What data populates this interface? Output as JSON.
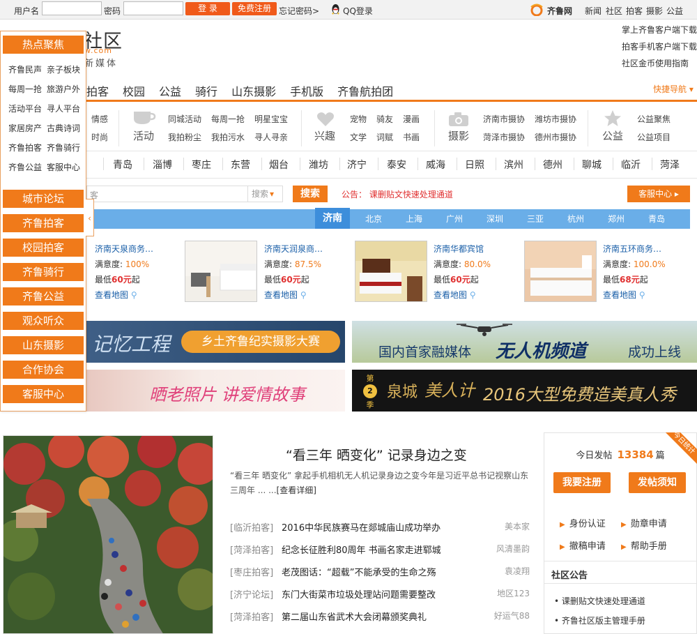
{
  "topbar": {
    "username_label": "用户名",
    "password_label": "密码",
    "login_label": "登  录",
    "register_label": "免费注册",
    "forgot_label": "忘记密码>",
    "qq_label": "QQ登录",
    "site_name": "齐鲁网",
    "right_links": [
      "新闻",
      "社区",
      "拍客",
      "摄影",
      "公益"
    ]
  },
  "header": {
    "logo_text": "社区",
    "logo_url": "w.com",
    "logo_tagline": "新媒体",
    "right_links": [
      "掌上齐鲁客户端下载",
      "拍客手机客户端下载",
      "社区金币使用指南"
    ]
  },
  "main_nav": {
    "items": [
      "拍客",
      "校园",
      "公益",
      "骑行",
      "山东摄影",
      "手机版",
      "齐鲁航拍团"
    ],
    "quick_nav": "快捷导航"
  },
  "categories": {
    "group0": [
      "情感",
      "时尚"
    ],
    "group1": {
      "title": "活动",
      "links": [
        "同城活动",
        "每周一抢",
        "明星宝宝",
        "我拍粉尘",
        "我拍污水",
        "寻人寻亲"
      ]
    },
    "group2": {
      "title": "兴趣",
      "links": [
        "宠物",
        "骑友",
        "漫画",
        "文学",
        "词赋",
        "书画"
      ]
    },
    "group3": {
      "title": "摄影",
      "links": [
        "济南市摄协",
        "潍坊市摄协",
        "菏泽市摄协",
        "德州市摄协"
      ]
    },
    "group4": {
      "title": "公益",
      "links": [
        "公益聚焦",
        "公益项目"
      ]
    }
  },
  "cities": [
    "青岛",
    "淄博",
    "枣庄",
    "东营",
    "烟台",
    "潍坊",
    "济宁",
    "泰安",
    "威海",
    "日照",
    "滨州",
    "德州",
    "聊城",
    "临沂",
    "菏泽"
  ],
  "search": {
    "placeholder": "客",
    "select_label": "搜索",
    "button_label": "搜索",
    "notice_label": "公告：",
    "notice_text": "课删贴文快速处理通道",
    "service_label": "客服中心"
  },
  "hotel_tabs": {
    "active": "济南",
    "tabs": [
      "北京",
      "上海",
      "广州",
      "深圳",
      "三亚",
      "杭州",
      "郑州",
      "青岛"
    ]
  },
  "hotels": [
    {
      "name": "济南天泉商务…",
      "satisfaction_label": "满意度:",
      "satisfaction": "100%",
      "price_prefix": "最低",
      "price": "60元",
      "price_suffix": "起",
      "map_label": "查看地图"
    },
    {
      "name": "济南天润泉商…",
      "satisfaction_label": "满意度:",
      "satisfaction": "87.5%",
      "price_prefix": "最低",
      "price": "60元",
      "price_suffix": "起",
      "map_label": "查看地图"
    },
    {
      "name": "济南华都宾馆",
      "satisfaction_label": "满意度:",
      "satisfaction": "80.0%",
      "price_prefix": "最低",
      "price": "60元",
      "price_suffix": "起",
      "map_label": "查看地图"
    },
    {
      "name": "济南五环商务…",
      "satisfaction_label": "满意度:",
      "satisfaction": "100.0%",
      "price_prefix": "最低",
      "price": "68元",
      "price_suffix": "起",
      "map_label": "查看地图"
    }
  ],
  "banners": {
    "b1_left": "记忆工程",
    "b1_right": "乡土齐鲁纪实摄影大赛",
    "b2_left": "国内首家融媒体",
    "b2_mid": "无人机频道",
    "b2_right": "成功上线",
    "b3_text": "晒老照片 讲爱情故事",
    "b4_season_top": "第",
    "b4_season_num": "2",
    "b4_season_bottom": "季",
    "b4_city": "泉城",
    "b4_brand": "美人计",
    "b4_text": "2016大型免费造美真人秀"
  },
  "feature": {
    "title": "“看三年 晒变化”  记录身边之变",
    "desc": "“看三年 晒变化” 拿起手机相机无人机记录身边之变今年是习近平总书记视察山东三周年 ... ...",
    "more_label": "[查看详细]"
  },
  "news": [
    {
      "cat": "[临沂拍客]",
      "title": "2016中华民族赛马在郯城庙山成功举办",
      "author": "美本家"
    },
    {
      "cat": "[菏泽拍客]",
      "title": "纪念长征胜利80周年 书画名家走进郓城",
      "author": "风清墨韵"
    },
    {
      "cat": "[枣庄拍客]",
      "title": "老茂图话：“超载”不能承受的生命之殇",
      "author": "袁凌翔"
    },
    {
      "cat": "[济宁论坛]",
      "title": "东门大街菜市垃圾处理站问题需要整改",
      "author": "地区123"
    },
    {
      "cat": "[菏泽拍客]",
      "title": "第二届山东省武术大会闭幕颁奖典礼",
      "author": "好运气88"
    }
  ],
  "stats": {
    "corner_label": "今日统计",
    "today_label": "今日发帖",
    "today_count": "13384",
    "today_unit": "篇",
    "register_btn": "我要注册",
    "post_btn": "发帖须知",
    "links": [
      "身份认证",
      "勋章申请",
      "撤稿申请",
      "帮助手册"
    ],
    "announce_title": "社区公告",
    "announcements": [
      "课删贴文快速处理通道",
      "齐鲁社区版主管理手册"
    ]
  },
  "left_panel": {
    "head": "热点聚焦",
    "links": [
      "齐鲁民声",
      "亲子板块",
      "每周一抢",
      "旅游户外",
      "活动平台",
      "寻人平台",
      "家居房产",
      "古典诗词",
      "齐鲁拍客",
      "齐鲁骑行",
      "齐鲁公益",
      "客服中心"
    ],
    "buttons": [
      "城市论坛",
      "齐鲁拍客",
      "校园拍客",
      "齐鲁骑行",
      "齐鲁公益",
      "观众听众",
      "山东摄影",
      "合作协会",
      "客服中心"
    ],
    "arrow": "‹"
  },
  "colors": {
    "accent": "#f07a1a",
    "tab_blue": "#6aaee8",
    "tab_active": "#3d8edb",
    "link": "#1a5fa8",
    "price": "#e03030"
  }
}
